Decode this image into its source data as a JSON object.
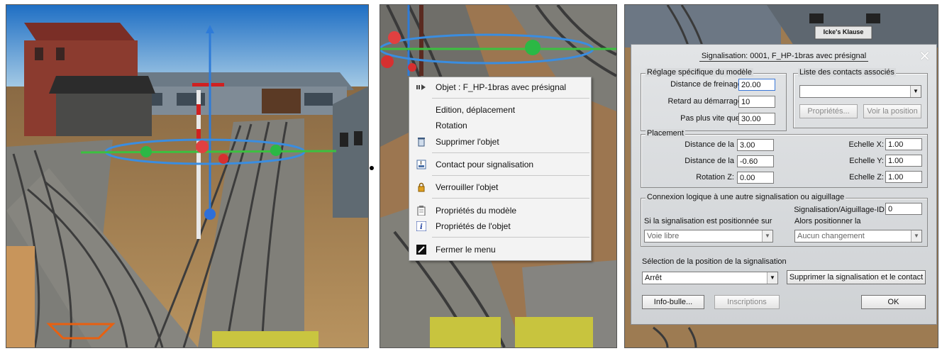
{
  "context_menu": {
    "items": [
      {
        "label": "Objet : F_HP-1bras avec présignal",
        "icon": "object-arrow-icon"
      },
      {
        "label": "Edition, déplacement",
        "icon": ""
      },
      {
        "label": "Rotation",
        "icon": ""
      },
      {
        "label": "Supprimer l'objet",
        "icon": "trash-icon"
      },
      {
        "label": "Contact pour signalisation",
        "icon": "contact-icon"
      },
      {
        "label": "Verrouiller l'objet",
        "icon": "lock-icon"
      },
      {
        "label": "Propriétés du modèle",
        "icon": "clipboard-icon"
      },
      {
        "label": "Propriétés de l'objet",
        "icon": "info-icon"
      },
      {
        "label": "Fermer le menu",
        "icon": "close-menu-icon"
      }
    ]
  },
  "scene": {
    "sign_label": "Icke's Klause"
  },
  "dialog": {
    "title": "Signalisation: 0001, F_HP-1bras avec présignal",
    "reglage": {
      "legend": "Réglage spécifique du modèle",
      "distance_freinage_label": "Distance de freinage",
      "distance_freinage_value": "20.00",
      "retard_label": "Retard au démarrage",
      "retard_value": "10",
      "vitesse_label": "Pas plus vite que:",
      "vitesse_value": "30.00"
    },
    "contacts": {
      "legend": "Liste des contacts associés",
      "selected": "",
      "props_button": "Propriétés...",
      "voir_button": "Voir la position"
    },
    "placement": {
      "legend": "Placement",
      "dist1_label": "Distance de la",
      "dist1_value": "3.00",
      "dist2_label": "Distance de la",
      "dist2_value": "-0.60",
      "rot_label": "Rotation Z:",
      "rot_value": "0.00",
      "ex_label": "Echelle X:",
      "ex_value": "1.00",
      "ey_label": "Echelle Y:",
      "ey_value": "1.00",
      "ez_label": "Echelle Z:",
      "ez_value": "1.00"
    },
    "connexion": {
      "legend": "Connexion logique à une autre signalisation ou aiguillage",
      "id_label": "Signalisation/Aiguillage-ID",
      "id_value": "0",
      "si_label": "Si la signalisation est positionnée sur",
      "si_value": "Voie libre",
      "alors_label": "Alors positionner la",
      "alors_value": "Aucun changement"
    },
    "selection": {
      "label": "Sélection de la position de la signalisation",
      "value": "Arrêt",
      "supprimer_button": "Supprimer la signalisation et le contact"
    },
    "buttons": {
      "info": "Info-bulle...",
      "inscriptions": "Inscriptions",
      "ok": "OK"
    }
  }
}
